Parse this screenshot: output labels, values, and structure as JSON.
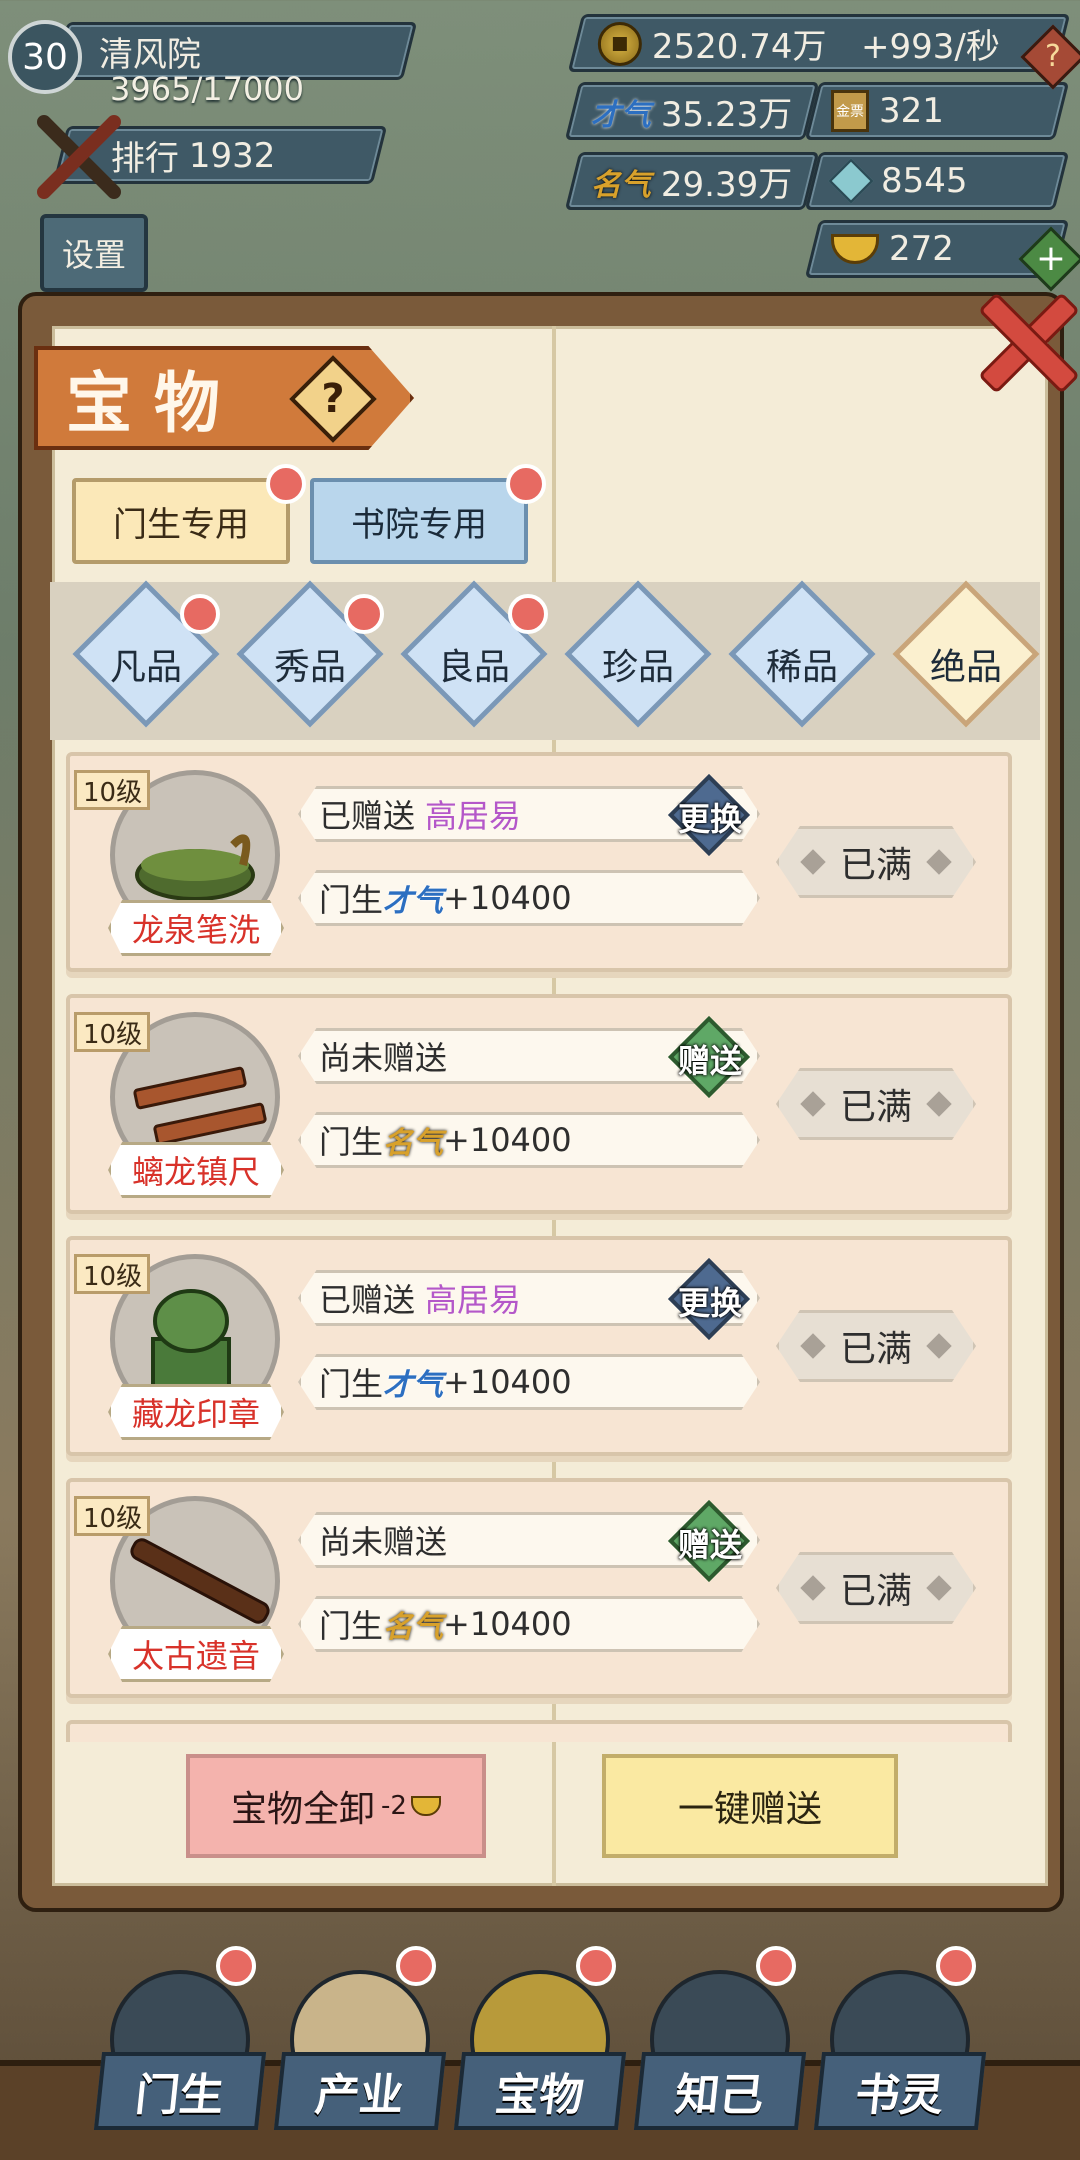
{
  "player": {
    "level": "30",
    "academy_name": "清风院",
    "exp": "3965/17000",
    "rank_label": "排行",
    "rank_value": "1932",
    "settings_label": "设置"
  },
  "resources": {
    "coins": "2520.74万",
    "coin_rate": "+993/秒",
    "talent_label": "才气",
    "talent": "35.23万",
    "fame_label": "名气",
    "fame": "29.39万",
    "gold_token_label": "金票",
    "gold_tokens": "321",
    "gems": "8545",
    "ingots": "272"
  },
  "panel": {
    "title": "宝物",
    "tabs": [
      {
        "label": "门生专用"
      },
      {
        "label": "书院专用"
      }
    ],
    "grades": [
      {
        "label": "凡品"
      },
      {
        "label": "秀品"
      },
      {
        "label": "良品"
      },
      {
        "label": "珍品"
      },
      {
        "label": "稀品"
      },
      {
        "label": "绝品"
      }
    ],
    "items": [
      {
        "level": "10级",
        "name": "龙泉笔洗",
        "status": "已赠送",
        "recipient": "高居易",
        "action": "更换",
        "bonus_prefix": "门生",
        "bonus_stat": "才气",
        "bonus_value": "+10400",
        "full": "已满"
      },
      {
        "level": "10级",
        "name": "螭龙镇尺",
        "status": "尚未赠送",
        "recipient": "",
        "action": "赠送",
        "bonus_prefix": "门生",
        "bonus_stat": "名气",
        "bonus_value": "+10400",
        "full": "已满"
      },
      {
        "level": "10级",
        "name": "藏龙印章",
        "status": "已赠送",
        "recipient": "高居易",
        "action": "更换",
        "bonus_prefix": "门生",
        "bonus_stat": "才气",
        "bonus_value": "+10400",
        "full": "已满"
      },
      {
        "level": "10级",
        "name": "太古遗音",
        "status": "尚未赠送",
        "recipient": "",
        "action": "赠送",
        "bonus_prefix": "门生",
        "bonus_stat": "名气",
        "bonus_value": "+10400",
        "full": "已满"
      }
    ],
    "buttons": {
      "unequip_all": "宝物全卸",
      "unequip_cost": "-2",
      "gift_all": "一键赠送"
    }
  },
  "nav": [
    {
      "label": "门生"
    },
    {
      "label": "产业"
    },
    {
      "label": "宝物"
    },
    {
      "label": "知己"
    },
    {
      "label": "书灵"
    }
  ],
  "colors": {
    "recipient": "#b457c9",
    "item_name": "#d8322a",
    "notification_dot": "#e76a62",
    "swap_action": "#4e6a90",
    "gift_action": "#5fa866"
  }
}
